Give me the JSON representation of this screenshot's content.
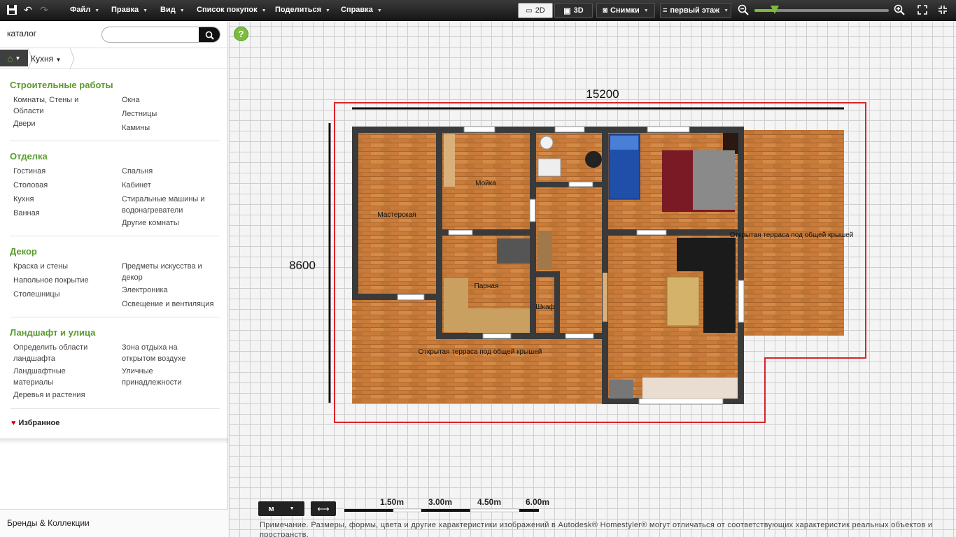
{
  "toolbar": {
    "menus": [
      "Файл",
      "Правка",
      "Вид",
      "Список покупок",
      "Поделиться",
      "Справка"
    ],
    "view_2d": "2D",
    "view_3d": "3D",
    "snapshots": "Снимки",
    "floor": "первый этаж",
    "zoom_level": 0.15
  },
  "sidebar": {
    "catalog_title": "каталог",
    "search_placeholder": "",
    "breadcrumb": "Кухня",
    "categories": [
      {
        "title": "Строительные работы",
        "col1": [
          "Комнаты, Стены и Области",
          "Двери"
        ],
        "col2": [
          "Окна",
          "Лестницы",
          "Камины"
        ]
      },
      {
        "title": "Отделка",
        "col1": [
          "Гостиная",
          "Столовая",
          "Кухня",
          "Ванная"
        ],
        "col2": [
          "Спальня",
          "Кабинет",
          "Стиральные машины и водонагреватели",
          "Другие комнаты"
        ]
      },
      {
        "title": "Декор",
        "col1": [
          "Краска и стены",
          "Напольное покрытие",
          "Столешницы"
        ],
        "col2": [
          "Предметы искусства и декор",
          "Электроника",
          "Освещение и вентиляция"
        ]
      },
      {
        "title": "Ландшафт и улица",
        "col1": [
          "Определить области ландшафта",
          "Ландшафтные материалы",
          "Деревья и растения"
        ],
        "col2": [
          "Зона отдыха на открытом воздухе",
          "Уличные принадлежности"
        ]
      }
    ],
    "favorites": "Избранное",
    "brands": "Бренды & Коллекции"
  },
  "plan": {
    "width_dim": "15200",
    "height_dim": "8600",
    "rooms": {
      "workshop": "Мастерская",
      "wash": "Мойка",
      "steam": "Парная",
      "closet": "Шкаф",
      "terrace_right": "Открытая терраса под общей крышей",
      "terrace_bottom": "Открытая терраса под общей крышей"
    },
    "colors": {
      "outline": "#d9232a",
      "wall": "#3a3a3a",
      "floor": "#c87b3a"
    }
  },
  "bottom": {
    "unit": "м",
    "scale_labels": [
      "1.50m",
      "3.00m",
      "4.50m",
      "6.00m"
    ],
    "note": "Примечание. Размеры, формы, цвета и другие характеристики изображений в Autodesk® Homestyler® могут отличаться от соответствующих характеристик реальных объектов и пространств."
  }
}
